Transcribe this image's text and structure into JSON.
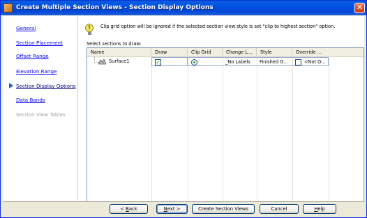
{
  "window": {
    "title": "Create Multiple Section Views - Section Display Options",
    "close_glyph": "✕"
  },
  "nav": {
    "items": [
      {
        "label": "General",
        "state": "link"
      },
      {
        "label": "Section Placement",
        "state": "link"
      },
      {
        "label": "Offset Range",
        "state": "link"
      },
      {
        "label": "Elevation Range",
        "state": "link"
      },
      {
        "label": "Section Display Options",
        "state": "active"
      },
      {
        "label": "Data Bands",
        "state": "link"
      },
      {
        "label": "Section View Tables",
        "state": "disabled"
      }
    ]
  },
  "info": {
    "icon": "lightbulb-icon",
    "text": "Clip grid option will be ignored if the selected section view style is set \"clip to highest section\" option."
  },
  "table": {
    "label": "Select sections to draw:",
    "columns": [
      "Name",
      "Draw",
      "Clip Grid",
      "Change L...",
      "Style",
      "Override ..."
    ],
    "rows": [
      {
        "name": "Surface1",
        "draw": true,
        "clip_grid": true,
        "change_labels": "_No Labels",
        "style": "Finished G...",
        "override_checked": false,
        "override_value": "<Not O..."
      }
    ]
  },
  "buttons": {
    "back_prefix": "< ",
    "back_mnemonic": "B",
    "back_rest": "ack",
    "next_mnemonic": "N",
    "next_rest": "ext >",
    "create": "Create Section Views",
    "cancel": "Cancel",
    "help_mnemonic": "H",
    "help_rest": "elp"
  },
  "colors": {
    "title_bar": "#0052e6",
    "link": "#0000ff",
    "check_green": "#21a121"
  }
}
